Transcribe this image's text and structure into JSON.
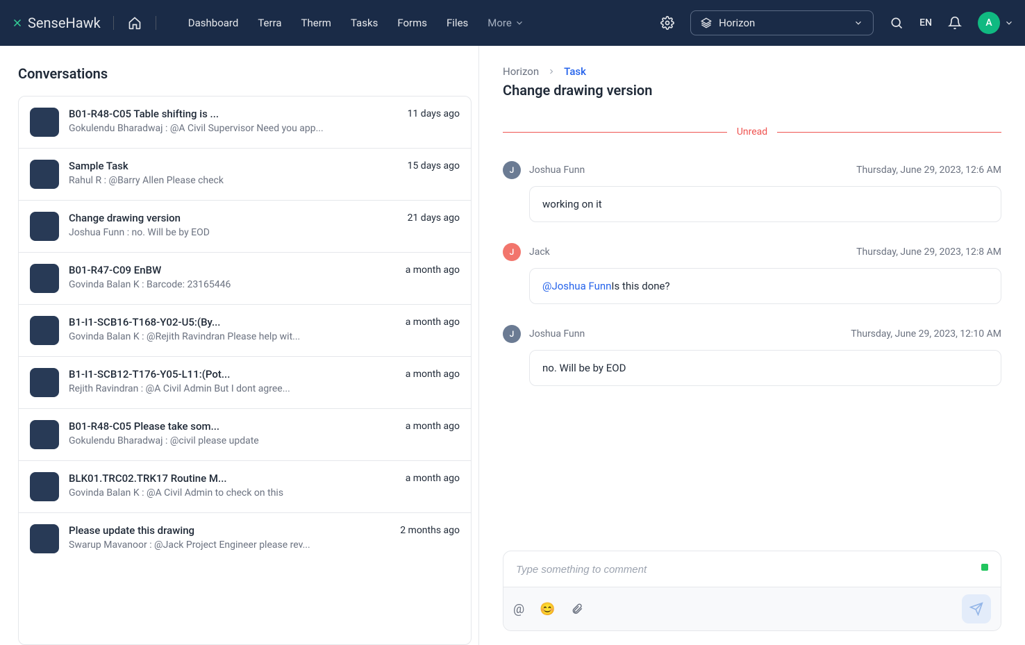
{
  "header": {
    "logo": "SenseHawk",
    "nav": [
      "Dashboard",
      "Terra",
      "Therm",
      "Tasks",
      "Forms",
      "Files"
    ],
    "more": "More",
    "project": "Horizon",
    "lang": "EN",
    "avatar_initial": "A"
  },
  "left": {
    "title": "Conversations",
    "items": [
      {
        "title": "B01-R48-C05 Table shifting is ...",
        "author": "Gokulendu Bharadwaj",
        "preview": "@A Civil Supervisor Need you app...",
        "time": "11 days ago"
      },
      {
        "title": "Sample Task",
        "author": "Rahul R",
        "preview": "@Barry Allen Please check",
        "time": "15 days ago"
      },
      {
        "title": "Change drawing version",
        "author": "Joshua Funn",
        "preview": "no. Will be by EOD",
        "time": "21 days ago"
      },
      {
        "title": "B01-R47-C09 EnBW",
        "author": "Govinda Balan K",
        "preview": "Barcode: 23165446",
        "time": "a month ago"
      },
      {
        "title": "B1-I1-SCB16-T168-Y02-U5:(By...",
        "author": "Govinda Balan K",
        "preview": "@Rejith Ravindran Please help wit...",
        "time": "a month ago"
      },
      {
        "title": "B1-I1-SCB12-T176-Y05-L11:(Pot...",
        "author": "Rejith Ravindran",
        "preview": "@A Civil Admin But I dont agree...",
        "time": "a month ago"
      },
      {
        "title": "B01-R48-C05 Please take som...",
        "author": "Gokulendu Bharadwaj",
        "preview": "@civil please update",
        "time": "a month ago"
      },
      {
        "title": "BLK01.TRC02.TRK17 Routine M...",
        "author": "Govinda Balan K",
        "preview": "@A Civil Admin to check on this",
        "time": "a month ago"
      },
      {
        "title": "Please update this drawing",
        "author": "Swarup Mavanoor",
        "preview": "@Jack Project Engineer please rev...",
        "time": "2 months ago"
      }
    ]
  },
  "right": {
    "breadcrumb": {
      "project": "Horizon",
      "section": "Task"
    },
    "title": "Change drawing version",
    "unread_label": "Unread",
    "messages": [
      {
        "initial": "J",
        "color": "#6b7b93",
        "name": "Joshua Funn",
        "time": "Thursday, June 29, 2023, 12:6 AM",
        "text": "working on it",
        "mention": ""
      },
      {
        "initial": "J",
        "color": "#f2756c",
        "name": "Jack",
        "time": "Thursday, June 29, 2023, 12:8 AM",
        "text": "Is this done?",
        "mention": "@Joshua Funn"
      },
      {
        "initial": "J",
        "color": "#6b7b93",
        "name": "Joshua Funn",
        "time": "Thursday, June 29, 2023, 12:10 AM",
        "text": "no. Will be by EOD",
        "mention": ""
      }
    ],
    "composer_placeholder": "Type something to comment"
  }
}
